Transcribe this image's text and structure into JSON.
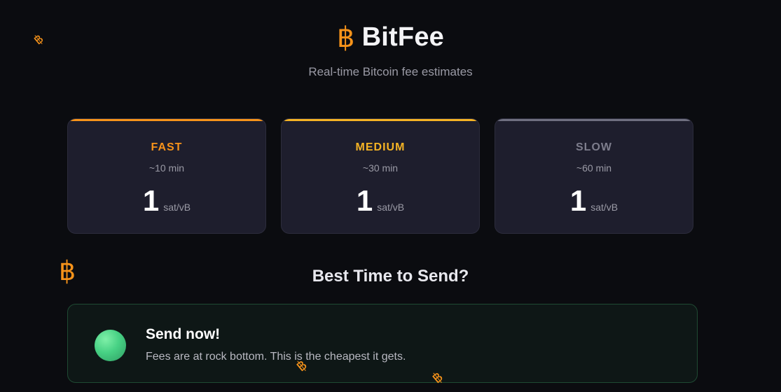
{
  "app": {
    "title": "BitFee",
    "icon": "bitcoin-icon",
    "subtitle": "Real-time Bitcoin fee estimates",
    "accent_color": "#f7931a"
  },
  "cards": [
    {
      "label": "FAST",
      "time": "~10 min",
      "value": "1",
      "unit": "sat/vB",
      "accent": "#f7931a"
    },
    {
      "label": "MEDIUM",
      "time": "~30 min",
      "value": "1",
      "unit": "sat/vB",
      "accent": "#f5b324"
    },
    {
      "label": "SLOW",
      "time": "~60 min",
      "value": "1",
      "unit": "sat/vB",
      "accent": "#6f6f80"
    }
  ],
  "section": {
    "title": "Best Time to Send?"
  },
  "recommendation": {
    "title": "Send now!",
    "text": "Fees are at rock bottom. This is the cheapest it gets.",
    "status_color": "#47d184"
  },
  "decorations": {
    "floating_icon_glyph": "฿"
  }
}
